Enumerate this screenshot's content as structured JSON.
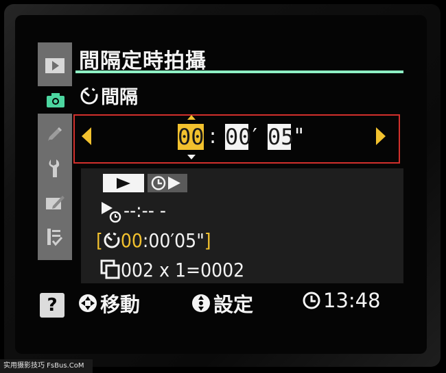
{
  "menu": {
    "title": "間隔定時拍攝",
    "subtitle": "間隔"
  },
  "sidebar": {
    "items": [
      {
        "icon": "playback-icon",
        "active": false
      },
      {
        "icon": "camera-icon",
        "active": true
      },
      {
        "icon": "pencil-icon",
        "active": false
      },
      {
        "icon": "wrench-icon",
        "active": false
      },
      {
        "icon": "retouch-icon",
        "active": false
      },
      {
        "icon": "my-menu-icon",
        "active": false
      }
    ],
    "help_label": "?"
  },
  "interval": {
    "hours": "00",
    "minutes": "00",
    "seconds": "05",
    "sep1": ":",
    "sep2": "′",
    "sep3": "\""
  },
  "info": {
    "start_time": "--:-- -",
    "interval_prefix": "00",
    "interval_rest": ":00′05\"",
    "shots": "002 x 1=0002"
  },
  "footer": {
    "move_label": "移動",
    "set_label": "設定",
    "clock": "13:48"
  },
  "colors": {
    "accent_yellow": "#f2c12e",
    "selection_red": "#d3302c",
    "title_underline": "#8ef0c4",
    "sidebar_gray": "#6e6e6e",
    "camera_active_green": "#4cd6a0"
  },
  "watermark": "实用摄影技巧 FsBus.CoM"
}
